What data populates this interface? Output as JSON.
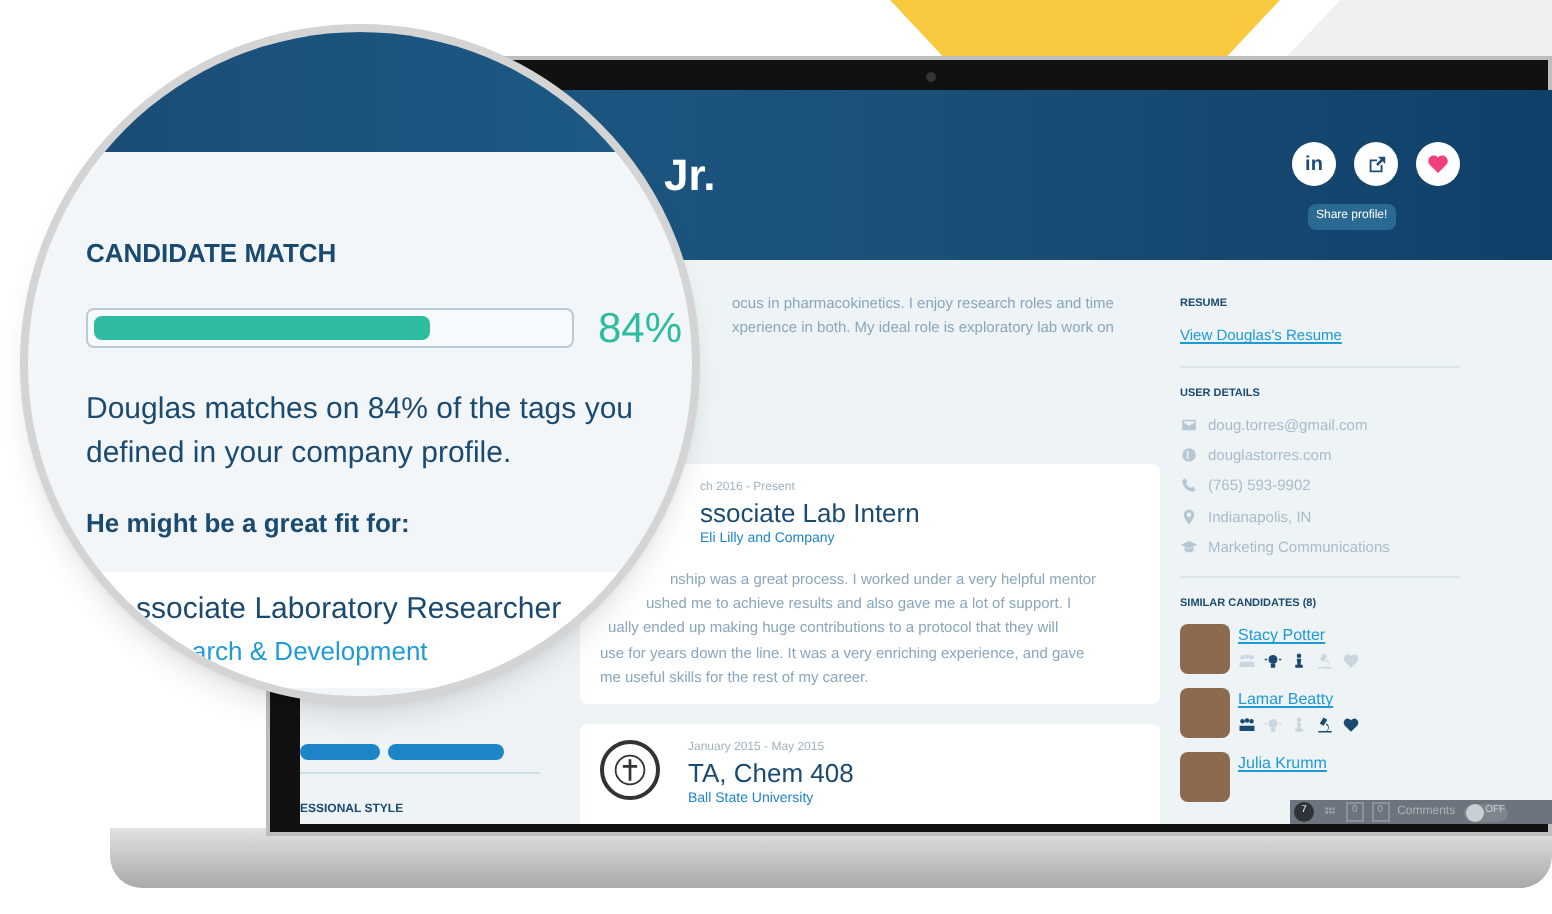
{
  "magnifier": {
    "heading": "CANDIDATE MATCH",
    "match": {
      "level": 0.71,
      "reading": "84%"
    },
    "summary": "Douglas matches on 84% of the tags you defined in your company profile.",
    "fit_heading": "He might be a great fit for:",
    "fit_role": {
      "title": "ssociate Laboratory Researcher",
      "department": "arch & Development"
    }
  },
  "profile_header": {
    "name": "Jr.",
    "actions": [
      {
        "kind": "linkedin",
        "label": "in"
      },
      {
        "kind": "share"
      },
      {
        "kind": "heart"
      }
    ],
    "tooltip": "Share profile!"
  },
  "left_column": {
    "section_heading": "ESSIONAL STYLE"
  },
  "about": [
    "ocus in pharmacokinetics. I enjoy research roles and time",
    "xperience in both. My ideal role is exploratory lab work on"
  ],
  "experience": [
    {
      "kind": "cut",
      "dates": "ch 2016 - Present",
      "title": "ssociate Lab Intern",
      "company": "Eli Lilly and Company",
      "lines": [
        "nship was a great process. I worked under a very helpful mentor",
        "ushed me to achieve results and also gave me a lot of support. I",
        "ually ended up making huge contributions to a protocol that they will",
        "use for years down the line. It was a very enriching experience, and gave",
        "me useful skills for the rest of my career."
      ]
    },
    {
      "kind": "logo",
      "dates": "January 2015 - May 2015",
      "title": "TA, Chem 408",
      "company": "Ball State University"
    }
  ],
  "resume": {
    "heading": "RESUME",
    "link": "View Douglas's Resume"
  },
  "user_details": {
    "heading": "USER DETAILS",
    "items": [
      {
        "kind": "email",
        "text": "doug.torres@gmail.com"
      },
      {
        "kind": "web",
        "text": "douglastorres.com"
      },
      {
        "kind": "phone",
        "text": "(765) 593-9902"
      },
      {
        "kind": "location",
        "text": "Indianapolis, IN"
      },
      {
        "kind": "education",
        "text": "Marketing Communications"
      }
    ]
  },
  "similar": {
    "heading": "SIMILAR CANDIDATES (8)",
    "candidates": [
      {
        "name": "Stacy Potter",
        "tags": [
          {
            "kind": "people",
            "on": false
          },
          {
            "kind": "bulb",
            "on": true
          },
          {
            "kind": "pawn",
            "on": true
          },
          {
            "kind": "microscope",
            "on": false
          },
          {
            "kind": "heart",
            "on": false
          }
        ]
      },
      {
        "name": "Lamar Beatty",
        "tags": [
          {
            "kind": "people",
            "on": true
          },
          {
            "kind": "bulb",
            "on": false
          },
          {
            "kind": "pawn",
            "on": false
          },
          {
            "kind": "microscope",
            "on": true
          },
          {
            "kind": "heart",
            "on": true
          }
        ]
      },
      {
        "name": "Julia Krumm"
      }
    ]
  },
  "comments_bar": {
    "badge": "7",
    "count_a": "0",
    "count_b": "0",
    "label": "Comments",
    "toggle": {
      "on": false,
      "label": "OFF"
    }
  }
}
